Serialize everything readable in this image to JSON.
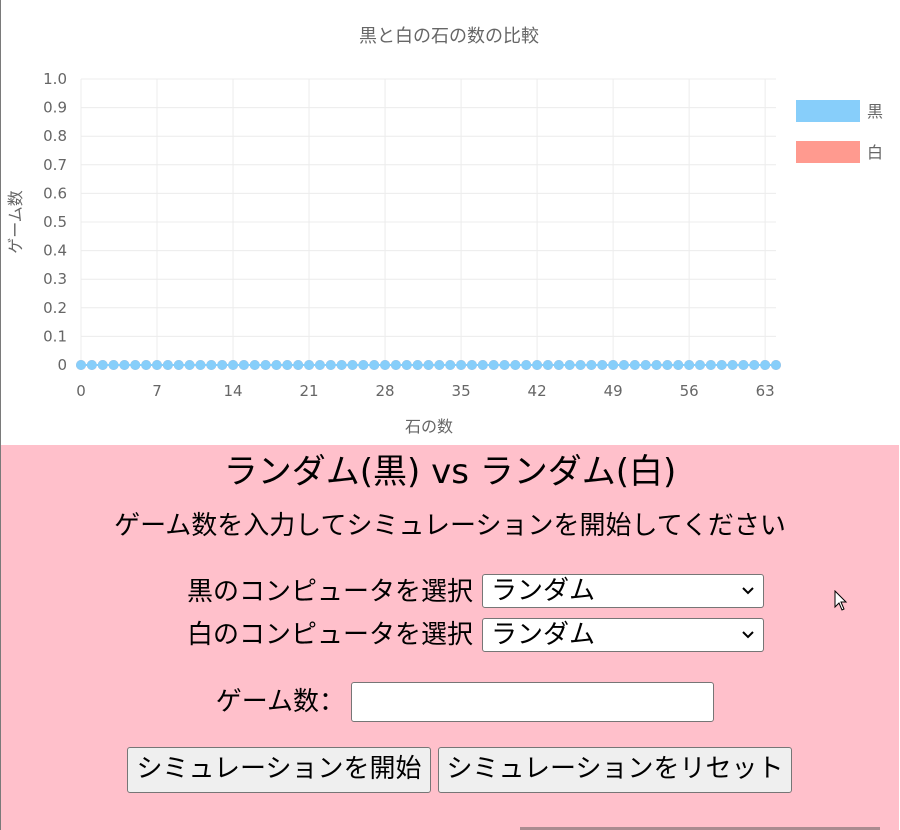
{
  "chart_data": {
    "type": "line",
    "title": "黒と白の石の数の比較",
    "xlabel": "石の数",
    "ylabel": "ゲーム数",
    "x": [
      0,
      1,
      2,
      3,
      4,
      5,
      6,
      7,
      8,
      9,
      10,
      11,
      12,
      13,
      14,
      15,
      16,
      17,
      18,
      19,
      20,
      21,
      22,
      23,
      24,
      25,
      26,
      27,
      28,
      29,
      30,
      31,
      32,
      33,
      34,
      35,
      36,
      37,
      38,
      39,
      40,
      41,
      42,
      43,
      44,
      45,
      46,
      47,
      48,
      49,
      50,
      51,
      52,
      53,
      54,
      55,
      56,
      57,
      58,
      59,
      60,
      61,
      62,
      63,
      64
    ],
    "x_ticks": [
      "0",
      "7",
      "14",
      "21",
      "28",
      "35",
      "42",
      "49",
      "56",
      "63"
    ],
    "y_ticks": [
      "0",
      "0.1",
      "0.2",
      "0.3",
      "0.4",
      "0.5",
      "0.6",
      "0.7",
      "0.8",
      "0.9",
      "1.0"
    ],
    "ylim": [
      0,
      1.0
    ],
    "xlim": [
      0,
      64
    ],
    "grid": true,
    "legend_position": "top-right",
    "series": [
      {
        "name": "黒",
        "color": "#87cefa",
        "values": [
          0,
          0,
          0,
          0,
          0,
          0,
          0,
          0,
          0,
          0,
          0,
          0,
          0,
          0,
          0,
          0,
          0,
          0,
          0,
          0,
          0,
          0,
          0,
          0,
          0,
          0,
          0,
          0,
          0,
          0,
          0,
          0,
          0,
          0,
          0,
          0,
          0,
          0,
          0,
          0,
          0,
          0,
          0,
          0,
          0,
          0,
          0,
          0,
          0,
          0,
          0,
          0,
          0,
          0,
          0,
          0,
          0,
          0,
          0,
          0,
          0,
          0,
          0,
          0,
          0
        ]
      },
      {
        "name": "白",
        "color": "#ff9a8f",
        "values": [
          0,
          0,
          0,
          0,
          0,
          0,
          0,
          0,
          0,
          0,
          0,
          0,
          0,
          0,
          0,
          0,
          0,
          0,
          0,
          0,
          0,
          0,
          0,
          0,
          0,
          0,
          0,
          0,
          0,
          0,
          0,
          0,
          0,
          0,
          0,
          0,
          0,
          0,
          0,
          0,
          0,
          0,
          0,
          0,
          0,
          0,
          0,
          0,
          0,
          0,
          0,
          0,
          0,
          0,
          0,
          0,
          0,
          0,
          0,
          0,
          0,
          0,
          0,
          0,
          0
        ]
      }
    ]
  },
  "panel": {
    "match_title": "ランダム(黒) vs ランダム(白)",
    "instruction": "ゲーム数を入力してシミュレーションを開始してください",
    "black_select_label": "黒のコンピュータを選択",
    "black_select_value": "ランダム",
    "white_select_label": "白のコンピュータを選択",
    "white_select_value": "ランダム",
    "games_label": "ゲーム数：",
    "games_value": "",
    "start_button": "シミュレーションを開始",
    "reset_button": "シミュレーションをリセット",
    "background": "#ffc0cb"
  }
}
